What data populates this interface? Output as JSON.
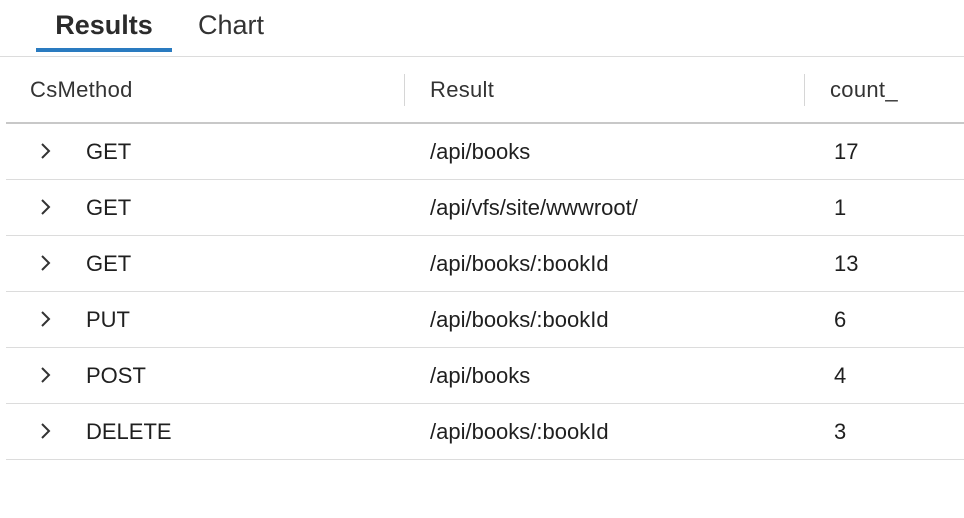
{
  "tabs": [
    {
      "label": "Results",
      "active": true
    },
    {
      "label": "Chart",
      "active": false
    }
  ],
  "accent_color": "#2a7bc0",
  "table": {
    "columns": [
      "CsMethod",
      "Result",
      "count_"
    ],
    "rows": [
      {
        "method": "GET",
        "result": "/api/books",
        "count": "17"
      },
      {
        "method": "GET",
        "result": "/api/vfs/site/wwwroot/",
        "count": "1"
      },
      {
        "method": "GET",
        "result": "/api/books/:bookId",
        "count": "13"
      },
      {
        "method": "PUT",
        "result": "/api/books/:bookId",
        "count": "6"
      },
      {
        "method": "POST",
        "result": "/api/books",
        "count": "4"
      },
      {
        "method": "DELETE",
        "result": "/api/books/:bookId",
        "count": "3"
      }
    ],
    "row_expand_icon": "chevron-right-icon"
  }
}
